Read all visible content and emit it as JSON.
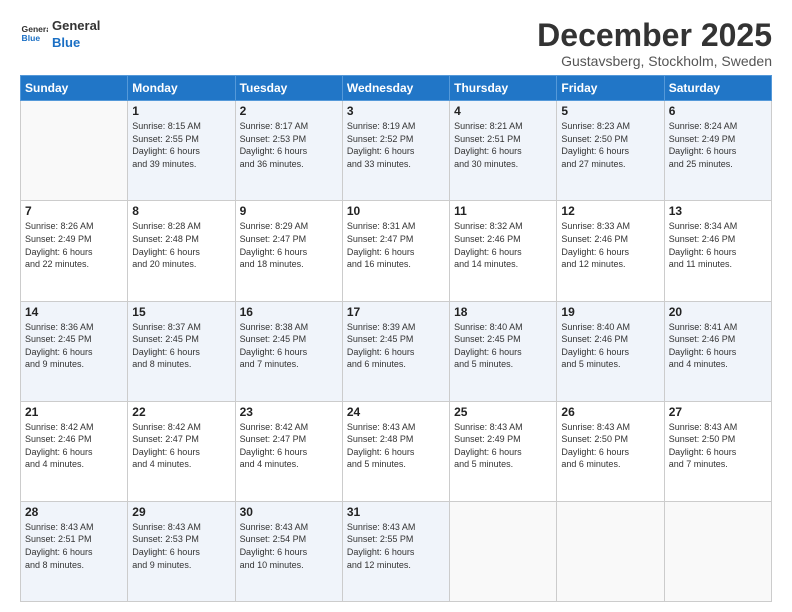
{
  "logo": {
    "line1": "General",
    "line2": "Blue"
  },
  "title": "December 2025",
  "subtitle": "Gustavsberg, Stockholm, Sweden",
  "days_of_week": [
    "Sunday",
    "Monday",
    "Tuesday",
    "Wednesday",
    "Thursday",
    "Friday",
    "Saturday"
  ],
  "weeks": [
    [
      {
        "day": "",
        "info": ""
      },
      {
        "day": "1",
        "info": "Sunrise: 8:15 AM\nSunset: 2:55 PM\nDaylight: 6 hours\nand 39 minutes."
      },
      {
        "day": "2",
        "info": "Sunrise: 8:17 AM\nSunset: 2:53 PM\nDaylight: 6 hours\nand 36 minutes."
      },
      {
        "day": "3",
        "info": "Sunrise: 8:19 AM\nSunset: 2:52 PM\nDaylight: 6 hours\nand 33 minutes."
      },
      {
        "day": "4",
        "info": "Sunrise: 8:21 AM\nSunset: 2:51 PM\nDaylight: 6 hours\nand 30 minutes."
      },
      {
        "day": "5",
        "info": "Sunrise: 8:23 AM\nSunset: 2:50 PM\nDaylight: 6 hours\nand 27 minutes."
      },
      {
        "day": "6",
        "info": "Sunrise: 8:24 AM\nSunset: 2:49 PM\nDaylight: 6 hours\nand 25 minutes."
      }
    ],
    [
      {
        "day": "7",
        "info": "Sunrise: 8:26 AM\nSunset: 2:49 PM\nDaylight: 6 hours\nand 22 minutes."
      },
      {
        "day": "8",
        "info": "Sunrise: 8:28 AM\nSunset: 2:48 PM\nDaylight: 6 hours\nand 20 minutes."
      },
      {
        "day": "9",
        "info": "Sunrise: 8:29 AM\nSunset: 2:47 PM\nDaylight: 6 hours\nand 18 minutes."
      },
      {
        "day": "10",
        "info": "Sunrise: 8:31 AM\nSunset: 2:47 PM\nDaylight: 6 hours\nand 16 minutes."
      },
      {
        "day": "11",
        "info": "Sunrise: 8:32 AM\nSunset: 2:46 PM\nDaylight: 6 hours\nand 14 minutes."
      },
      {
        "day": "12",
        "info": "Sunrise: 8:33 AM\nSunset: 2:46 PM\nDaylight: 6 hours\nand 12 minutes."
      },
      {
        "day": "13",
        "info": "Sunrise: 8:34 AM\nSunset: 2:46 PM\nDaylight: 6 hours\nand 11 minutes."
      }
    ],
    [
      {
        "day": "14",
        "info": "Sunrise: 8:36 AM\nSunset: 2:45 PM\nDaylight: 6 hours\nand 9 minutes."
      },
      {
        "day": "15",
        "info": "Sunrise: 8:37 AM\nSunset: 2:45 PM\nDaylight: 6 hours\nand 8 minutes."
      },
      {
        "day": "16",
        "info": "Sunrise: 8:38 AM\nSunset: 2:45 PM\nDaylight: 6 hours\nand 7 minutes."
      },
      {
        "day": "17",
        "info": "Sunrise: 8:39 AM\nSunset: 2:45 PM\nDaylight: 6 hours\nand 6 minutes."
      },
      {
        "day": "18",
        "info": "Sunrise: 8:40 AM\nSunset: 2:45 PM\nDaylight: 6 hours\nand 5 minutes."
      },
      {
        "day": "19",
        "info": "Sunrise: 8:40 AM\nSunset: 2:46 PM\nDaylight: 6 hours\nand 5 minutes."
      },
      {
        "day": "20",
        "info": "Sunrise: 8:41 AM\nSunset: 2:46 PM\nDaylight: 6 hours\nand 4 minutes."
      }
    ],
    [
      {
        "day": "21",
        "info": "Sunrise: 8:42 AM\nSunset: 2:46 PM\nDaylight: 6 hours\nand 4 minutes."
      },
      {
        "day": "22",
        "info": "Sunrise: 8:42 AM\nSunset: 2:47 PM\nDaylight: 6 hours\nand 4 minutes."
      },
      {
        "day": "23",
        "info": "Sunrise: 8:42 AM\nSunset: 2:47 PM\nDaylight: 6 hours\nand 4 minutes."
      },
      {
        "day": "24",
        "info": "Sunrise: 8:43 AM\nSunset: 2:48 PM\nDaylight: 6 hours\nand 5 minutes."
      },
      {
        "day": "25",
        "info": "Sunrise: 8:43 AM\nSunset: 2:49 PM\nDaylight: 6 hours\nand 5 minutes."
      },
      {
        "day": "26",
        "info": "Sunrise: 8:43 AM\nSunset: 2:50 PM\nDaylight: 6 hours\nand 6 minutes."
      },
      {
        "day": "27",
        "info": "Sunrise: 8:43 AM\nSunset: 2:50 PM\nDaylight: 6 hours\nand 7 minutes."
      }
    ],
    [
      {
        "day": "28",
        "info": "Sunrise: 8:43 AM\nSunset: 2:51 PM\nDaylight: 6 hours\nand 8 minutes."
      },
      {
        "day": "29",
        "info": "Sunrise: 8:43 AM\nSunset: 2:53 PM\nDaylight: 6 hours\nand 9 minutes."
      },
      {
        "day": "30",
        "info": "Sunrise: 8:43 AM\nSunset: 2:54 PM\nDaylight: 6 hours\nand 10 minutes."
      },
      {
        "day": "31",
        "info": "Sunrise: 8:43 AM\nSunset: 2:55 PM\nDaylight: 6 hours\nand 12 minutes."
      },
      {
        "day": "",
        "info": ""
      },
      {
        "day": "",
        "info": ""
      },
      {
        "day": "",
        "info": ""
      }
    ]
  ]
}
